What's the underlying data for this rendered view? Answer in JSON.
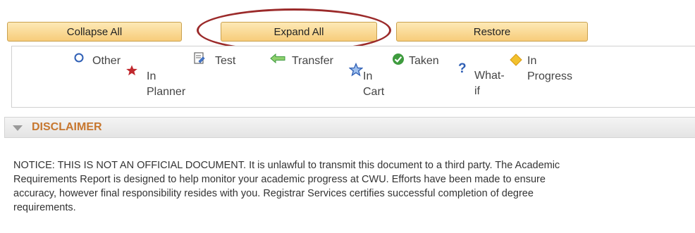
{
  "toolbar": {
    "collapse_label": "Collapse All",
    "expand_label": "Expand All",
    "restore_label": "Restore"
  },
  "legend": {
    "other": "Other",
    "in_planner": [
      "In",
      "Planner"
    ],
    "test": "Test",
    "transfer": "Transfer",
    "in_cart": [
      "In",
      "Cart"
    ],
    "taken": "Taken",
    "what_if": [
      "What-",
      "if"
    ],
    "in_progress": [
      "In",
      "Progress"
    ]
  },
  "disclaimer": {
    "title": "DISCLAIMER",
    "notice": "NOTICE: THIS IS NOT AN OFFICIAL DOCUMENT. It is unlawful to transmit this document to a third party. The Academic Requirements Report is designed to help monitor your academic progress at CWU. Efforts have been made to ensure accuracy, however final responsibility resides with you. Registrar Services certifies successful completion of degree requirements."
  },
  "colors": {
    "button_top": "#fde9b6",
    "button_bottom": "#f7cc7a",
    "highlight_oval": "#9b2a2a",
    "disclaimer_title": "#c7772f",
    "star_red": "#c0282d",
    "star_blue": "#2f5fb5",
    "check_green": "#3e9b3e",
    "diamond_yellow": "#f2c12e"
  }
}
